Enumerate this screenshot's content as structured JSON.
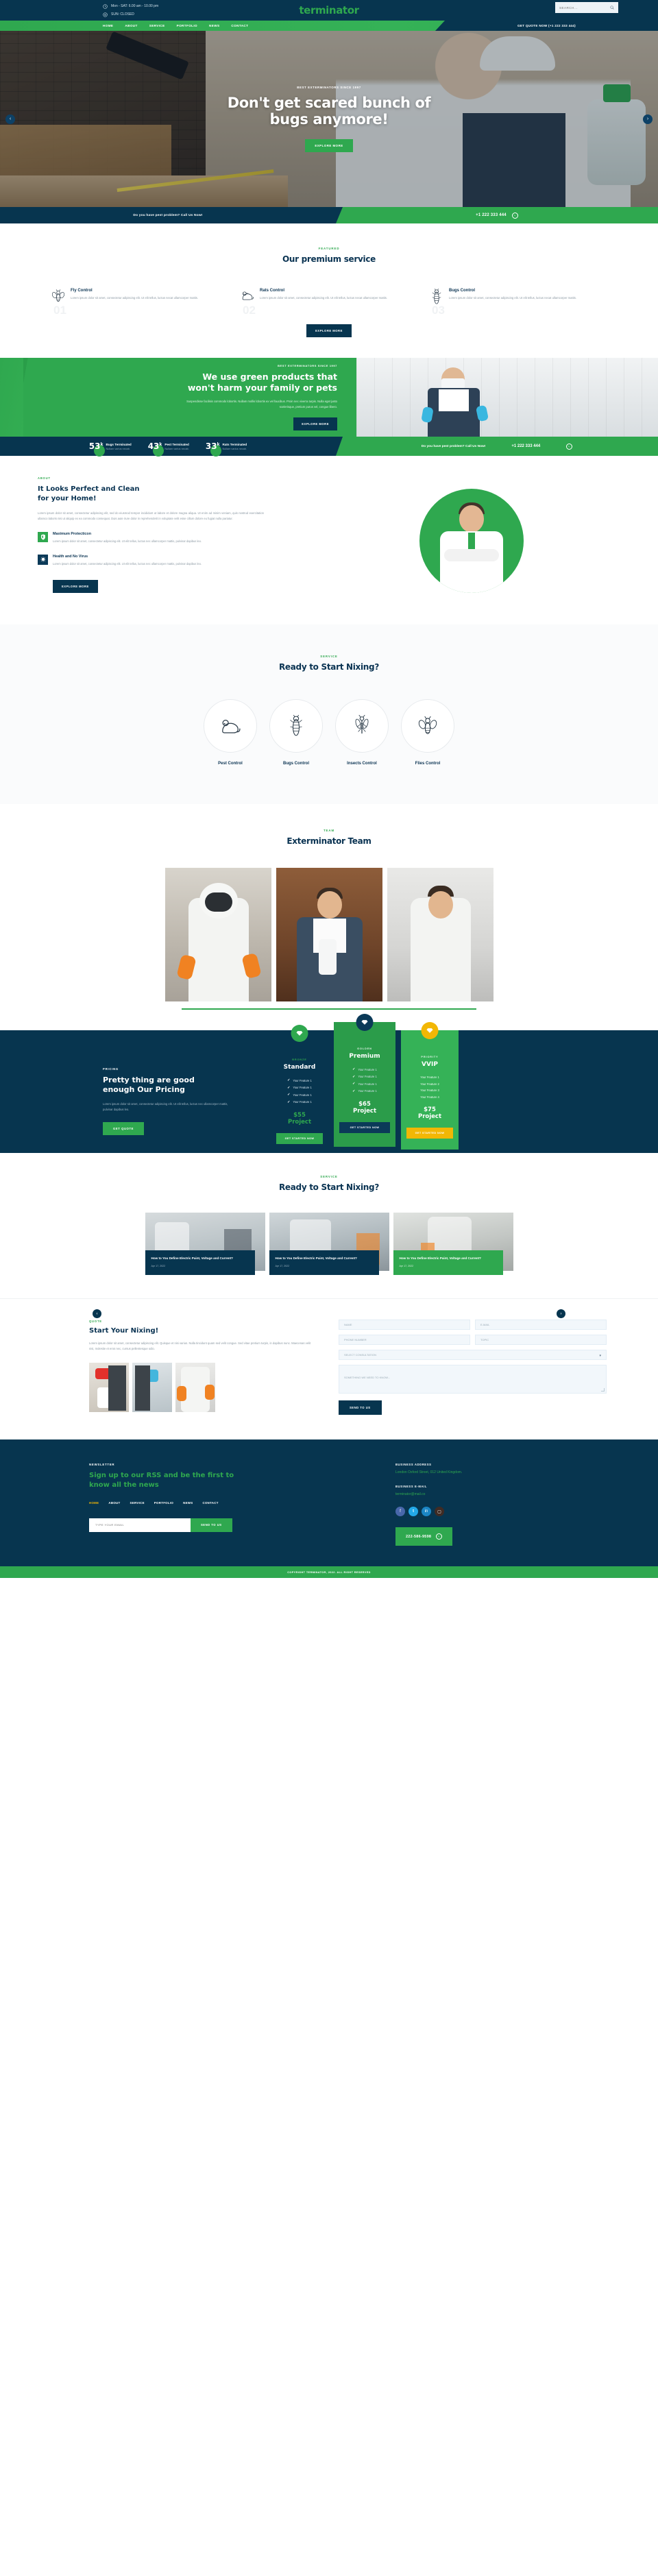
{
  "topbar": {
    "hours_weekday": "Mon - SAT: 6.00 am - 10.00 pm",
    "hours_sunday": "SUN: CLOSED",
    "logo": "terminator",
    "search_placeholder": "SEARCH..."
  },
  "nav": {
    "items": [
      "HOME",
      "ABOUT",
      "SERVICE",
      "PORTFOLIO",
      "NEWS",
      "CONTACT"
    ],
    "cta": "GET QUOTE NOW (+1 222 333 444)"
  },
  "hero": {
    "kicker": "BEST EXTERMINATORS SINCE 1997",
    "title_line1": "Don't get scared bunch of",
    "title_line2": "bugs anymore!",
    "button": "EXPLORE MORE",
    "prev": "‹",
    "next": "›"
  },
  "callbar": {
    "question": "Do you have pest problem? Call Us Now!",
    "phone": "+1 222 333 444"
  },
  "premium": {
    "kicker": "FEATURED",
    "title": "Our premium service",
    "button": "EXPLORE MORE",
    "features": [
      {
        "num": "01",
        "icon": "fly-icon",
        "title": "Fly Control",
        "text": "Lorem ipsum dolor sit amet, consectetur adipiscing elit. Ut elit tellus, luctus necat ullamcorper mattis."
      },
      {
        "num": "02",
        "icon": "rat-icon",
        "title": "Rats Control",
        "text": "Lorem ipsum dolor sit amet, consectetur adipiscing elit. Ut elit tellus, luctus necat ullamcorper mattis."
      },
      {
        "num": "03",
        "icon": "bug-icon",
        "title": "Bugs Control",
        "text": "Lorem ipsum dolor sit amet, consectetur adipiscing elit. Ut elit tellus, luctus necat ullamcorper mattis."
      }
    ]
  },
  "greenband": {
    "kicker": "BEST EXTERMINATORS SINCE 1997",
    "title_line1": "We use green products that",
    "title_line2": "won't harm your family or pets",
    "text": "Suspendisse facilisis commodo lobortis. Nullam mollis lobortis ex vel faucibus. Proin nec viverra turpis. Nulla eget justo scelerisque, pretium purus vel, congue libero.",
    "button": "EXPLORE MORE"
  },
  "stats": {
    "items": [
      {
        "value": "53",
        "suffix": "k",
        "title": "Bugs Terminated",
        "sub": "Nullam varius necab."
      },
      {
        "value": "43",
        "suffix": "k",
        "title": "Pest Terminated",
        "sub": "Nullam varius necab."
      },
      {
        "value": "33",
        "suffix": "k",
        "title": "Rats Terminated",
        "sub": "Nullam varius necab."
      }
    ],
    "question": "Do you have pest problem? Call Us Now!",
    "phone": "+1 222 333 444"
  },
  "about": {
    "kicker": "ABOUT",
    "title_line1": "It Looks Perfect and Clean",
    "title_line2": "for your Home!",
    "text": "Lorem ipsum dolor sit amet, consectetur adipiscing elit, sed do eiusmod tempor incididunt ut labore et dolore magna aliqua. Ut enim ad minim veniam, quis nostrud exercitation ullamco laboris nisi ut aliquip ex ea commodo consequat. Duis aute irure dolor in reprehenderit in voluptate velit esse cillum dolore eu fugiat nulla pariatur.",
    "items": [
      {
        "icon": "shield-icon",
        "title": "Maximum Protecticon",
        "text": "Lorem ipsum dolor sit amet, consectetur adipiscing elit. Ut elit tellus, luctus nec ullamcorper mattis, pulvinar dapibus leo."
      },
      {
        "icon": "virus-icon",
        "title": "Health and No Virus",
        "text": "Lorem ipsum dolor sit amet, consectetur adipiscing elit. Ut elit tellus, luctus nec ullamcorper mattis, pulvinar dapibus leo."
      }
    ],
    "button": "EXPLORE MORE"
  },
  "services": {
    "kicker": "SERVICE",
    "title": "Ready to Start Nixing?",
    "items": [
      {
        "icon": "rat-icon",
        "label": "Pest Control"
      },
      {
        "icon": "bug-icon",
        "label": "Bugs Control"
      },
      {
        "icon": "mosquito-icon",
        "label": "Insects Control"
      },
      {
        "icon": "fly-icon",
        "label": "Flies Control"
      }
    ]
  },
  "team": {
    "kicker": "TEAM",
    "title": "Exterminator Team"
  },
  "pricing": {
    "kicker": "PRICING",
    "title_line1": "Pretty thing are good",
    "title_line2": "enough Our Pricing",
    "text": "Lorem ipsum dolor sit amet, consectetur adipiscing elit. Ut elit tellus, luctus nec ullamcorper mattis, pulvinar dapibus leo.",
    "button": "GET QUOTE",
    "plans": [
      {
        "badge": "diamond-icon",
        "tier": "BRONZE",
        "name": "Standard",
        "features": [
          "Your Feature 1",
          "Your Feature 1",
          "Your Feature 1",
          "Your Feature 1"
        ],
        "price": "$55",
        "period": "Project",
        "cta": "GET STARTED NOW"
      },
      {
        "badge": "diamond-icon",
        "tier": "GOLDEN",
        "name": "Premium",
        "features": [
          "Your Feature 1",
          "Your Feature 1",
          "Your Feature 1",
          "Your Feature 1"
        ],
        "price": "$65",
        "period": "Project",
        "cta": "GET STARTED NOW"
      },
      {
        "badge": "diamond-icon",
        "tier": "PRIORITY",
        "name": "VVIP",
        "features": [
          "Your Feature 1",
          "Your Feature 2",
          "Your Feature 3",
          "Your Feature 4"
        ],
        "price": "$75",
        "period": "Project",
        "cta": "GET STARTED NOW"
      }
    ]
  },
  "news": {
    "kicker": "SERVICE",
    "title": "Ready to Start Nixing?",
    "prev": "‹",
    "next": "›",
    "posts": [
      {
        "title": "How to You Define Electric Paint, Voltage and Current?",
        "date": "Apr 17, 2022"
      },
      {
        "title": "How to You Define Electric Paint, Voltage and Current?",
        "date": "Apr 17, 2022"
      },
      {
        "title": "How to You Define Electric Paint, Voltage and Current?",
        "date": "Apr 17, 2022"
      }
    ]
  },
  "quote": {
    "kicker": "QUOTE",
    "title": "Start Your Nixing!",
    "text": "Lorem ipsum dolor sit amet, consectetur adipiscing elit. Quisque et nisi varius. Nulla tincidunt quam sed velit congue. Sed vitae pretium turpis, in dapibus nunc. Maecenas velit nisi, molestie et eros nec, cursus pellentesque odio.",
    "name_placeholder": "NAME",
    "email_placeholder": "E-MAIL",
    "phone_placeholder": "PHONE NUMBER",
    "topic_placeholder": "TOPIC",
    "select_value": "SELECT CONSULTATION",
    "message_placeholder": "SOMETHING WE NEED TO KNOW...",
    "button": "SEND TO US"
  },
  "footer": {
    "kicker": "NEWSLETTER",
    "title_line1": "Sign up to our RSS and be the first to",
    "title_line2": "know all the news",
    "nav": [
      "HOME",
      "ABOUT",
      "SERVICE",
      "PORTFOLIO",
      "NEWS",
      "CONTACT"
    ],
    "active_nav": "HOME",
    "email_placeholder": "TYPE YOUR EMAIL",
    "subscribe_button": "SEND TO US",
    "address_label": "BUSINESS ADDRESS",
    "address_value": "London Oxford Street, 012 United Kingdom.",
    "email_label": "BUSINESS E-MAIL",
    "email_value": "terminator@mail.co",
    "socials": [
      "facebook-icon",
      "twitter-icon",
      "linkedin-icon",
      "instagram-icon"
    ],
    "phone": "222-586-9598",
    "copyright": "COPYRIGHT TERMINATOR, 2022. ALL RIGHT RESERVED"
  },
  "colors": {
    "green": "#2fa84f",
    "navy": "#07354f",
    "gold": "#f2b705"
  }
}
